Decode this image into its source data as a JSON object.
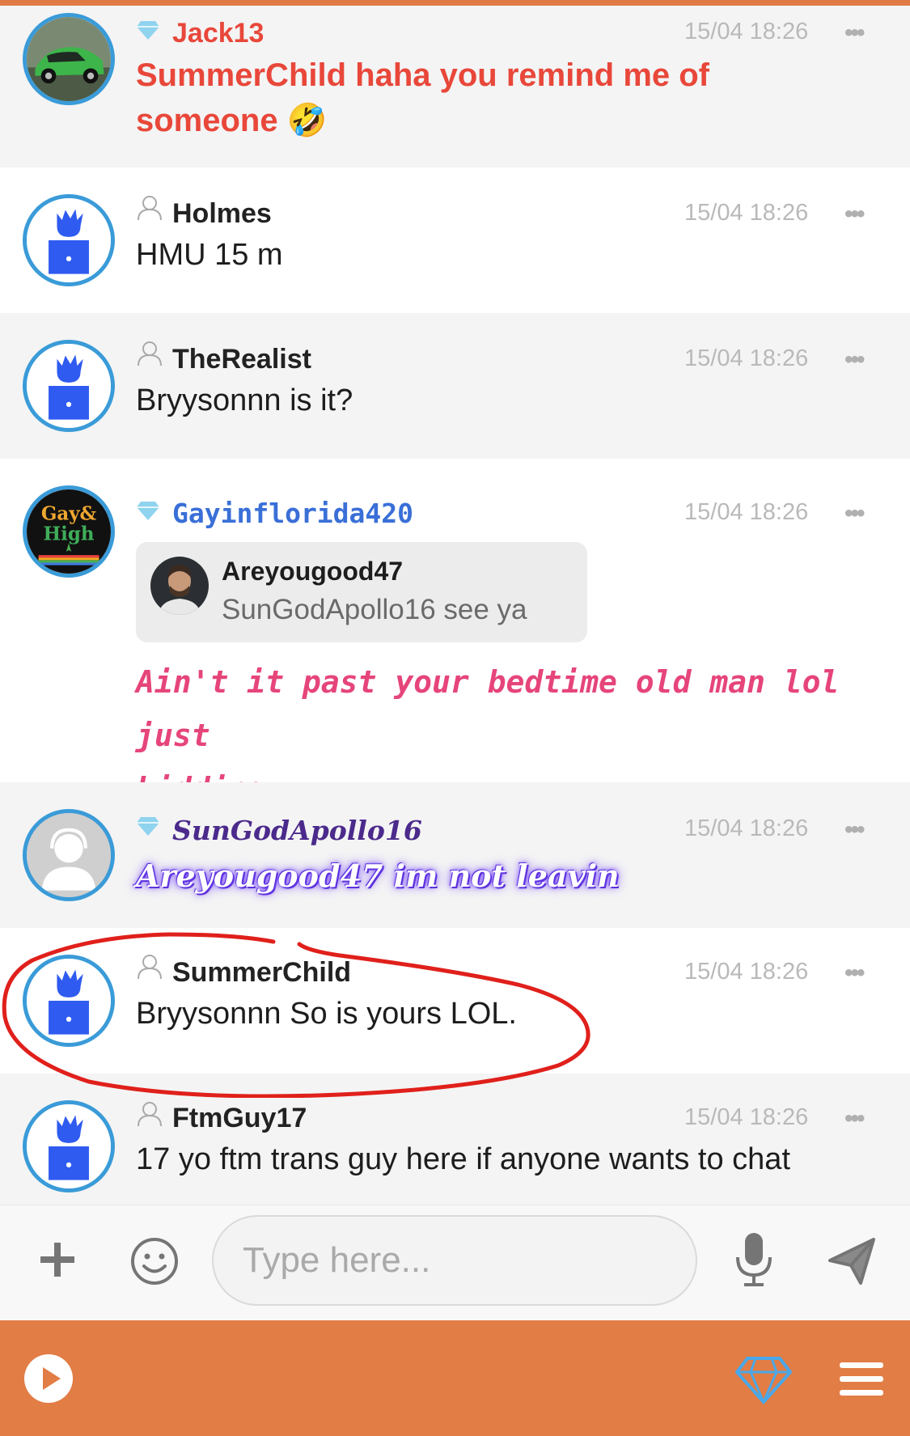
{
  "messages": [
    {
      "username": "Jack13",
      "time": "15/04 18:26",
      "more": "•••",
      "text_line1": "SummerChild haha you remind me of",
      "text_line2": "someone 🤣",
      "vip": true,
      "color": "#e8473a"
    },
    {
      "username": "Holmes",
      "time": "15/04 18:26",
      "more": "•••",
      "text": "HMU 15 m",
      "vip": false
    },
    {
      "username": "TheRealist",
      "time": "15/04 18:26",
      "more": "•••",
      "text": "Bryysonnn is it?",
      "vip": false
    },
    {
      "username": "Gayinflorida420",
      "time": "15/04 18:26",
      "more": "•••",
      "vip": true,
      "color": "#3a6fd8",
      "quote": {
        "username": "Areyougood47",
        "text": "SunGodApollo16 see ya"
      },
      "text_line1": "Ain't it past your bedtime old man lol just",
      "text_line2": "kidding",
      "text_color": "#e6457a",
      "avatar_text": [
        "Gay&",
        "High"
      ]
    },
    {
      "username": "SunGodApollo16",
      "time": "15/04 18:26",
      "more": "•••",
      "text": "Areyougood47 im not leavin",
      "vip": true,
      "color": "#4b2a8c"
    },
    {
      "username": "SummerChild",
      "time": "15/04 18:26",
      "more": "•••",
      "text": "Bryysonnn So is yours LOL.",
      "vip": false
    },
    {
      "username": "FtmGuy17",
      "time": "15/04 18:26",
      "more": "•••",
      "text": "17 yo ftm trans guy here if anyone wants to chat",
      "vip": false
    }
  ],
  "composer": {
    "placeholder": "Type here..."
  },
  "icons": [
    "plus-icon",
    "emoji-icon",
    "microphone-icon",
    "send-icon",
    "play-icon",
    "diamond-icon",
    "menu-icon",
    "diamond-badge-icon",
    "user-outline-icon"
  ],
  "colors": {
    "accent": "#e27d46",
    "avatar_border": "#3a9bd8",
    "annotation": "#e0201b"
  }
}
